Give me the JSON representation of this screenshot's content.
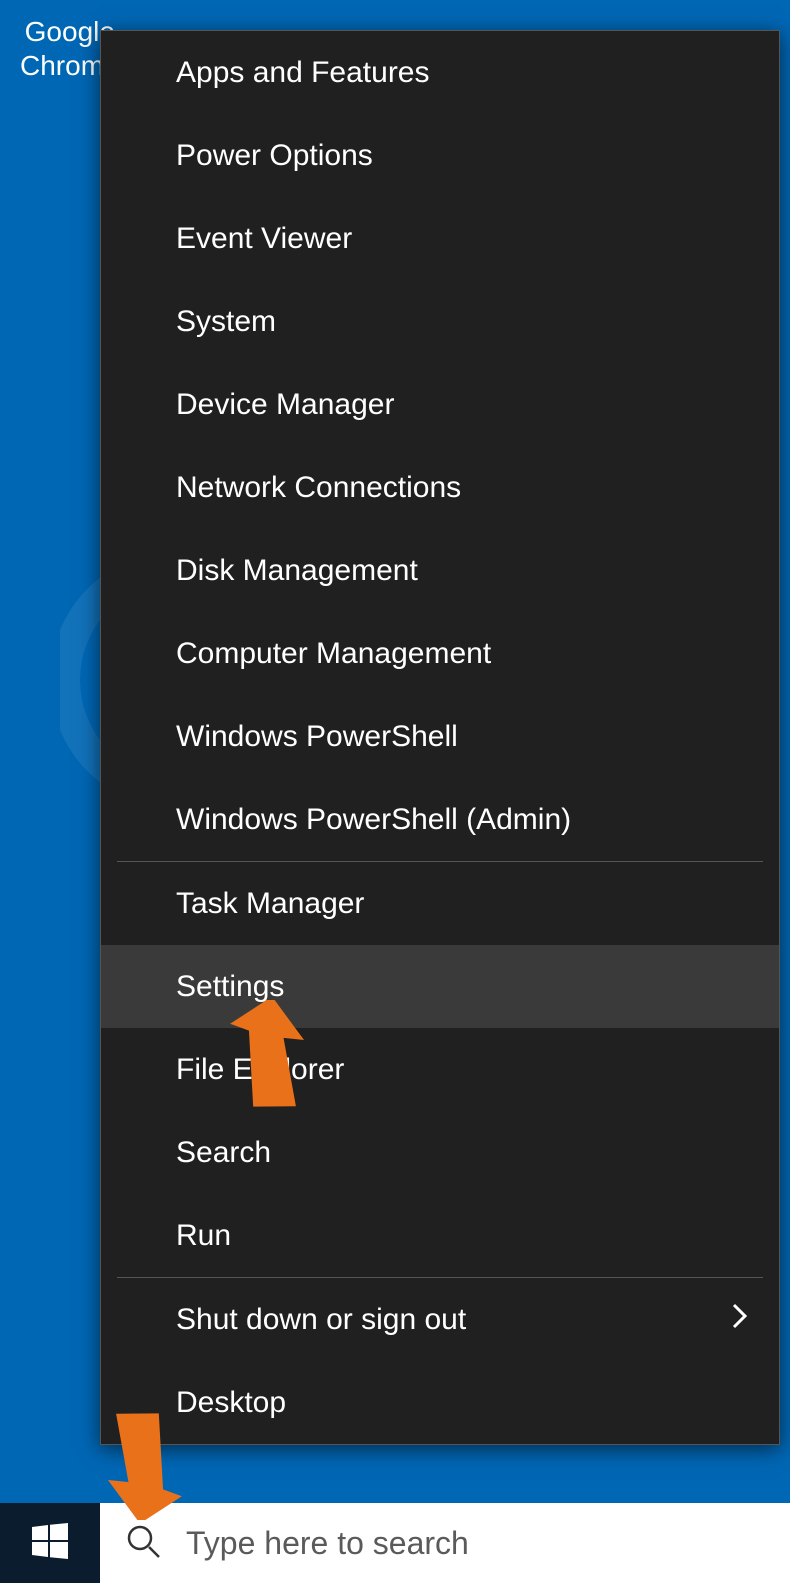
{
  "desktop": {
    "chrome_label_line1": "Google",
    "chrome_label_line2": "Chrome"
  },
  "menu": {
    "section1": [
      "Apps and Features",
      "Power Options",
      "Event Viewer",
      "System",
      "Device Manager",
      "Network Connections",
      "Disk Management",
      "Computer Management",
      "Windows PowerShell",
      "Windows PowerShell (Admin)"
    ],
    "section2": [
      "Task Manager",
      "Settings",
      "File Explorer",
      "Search",
      "Run"
    ],
    "section3_shutdown": "Shut down or sign out",
    "section3_desktop": "Desktop",
    "highlighted_index_section2": 1
  },
  "taskbar": {
    "search_placeholder": "Type here to search"
  }
}
